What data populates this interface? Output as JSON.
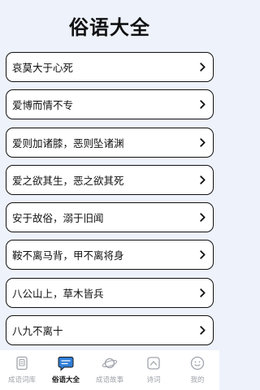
{
  "header": {
    "title": "俗语大全"
  },
  "items": [
    {
      "label": "哀莫大于心死"
    },
    {
      "label": "爱博而情不专"
    },
    {
      "label": "爱则加诸膝，恶则坠诸渊"
    },
    {
      "label": "爱之欲其生，恶之欲其死"
    },
    {
      "label": "安于故俗，溺于旧闻"
    },
    {
      "label": "鞍不离马背，甲不离将身"
    },
    {
      "label": "八公山上，草木皆兵"
    },
    {
      "label": "八九不离十"
    }
  ],
  "tabs": [
    {
      "label": "成语词库",
      "icon": "book-icon",
      "active": false
    },
    {
      "label": "俗语大全",
      "icon": "chat-icon",
      "active": true
    },
    {
      "label": "成语故事",
      "icon": "planet-icon",
      "active": false
    },
    {
      "label": "诗词",
      "icon": "chevron-up-icon",
      "active": false
    },
    {
      "label": "我的",
      "icon": "smiley-icon",
      "active": false
    }
  ],
  "colors": {
    "background": "#eef2fb",
    "active_tab": "#2f7ed8",
    "inactive_tab": "#a0a4ab"
  }
}
